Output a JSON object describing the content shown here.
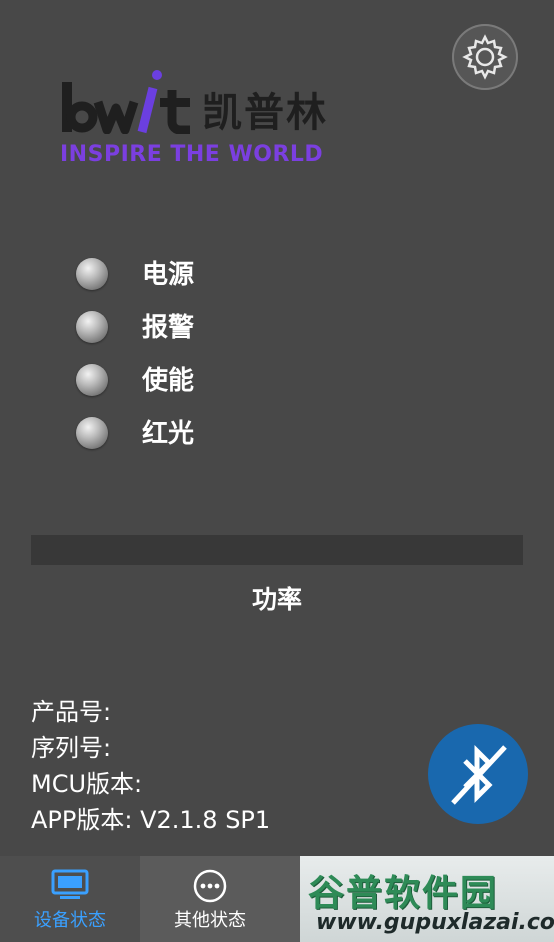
{
  "header": {
    "settings_icon": "gear-icon"
  },
  "logo": {
    "mark": "bwt",
    "brand_cn": "凯普林",
    "slogan": "INSPIRE THE WORLD",
    "colors": {
      "mark": "#1f1f1f",
      "accent": "#7b3fe0"
    }
  },
  "status": {
    "items": [
      {
        "label": "电源",
        "state": "off"
      },
      {
        "label": "报警",
        "state": "off"
      },
      {
        "label": "使能",
        "state": "off"
      },
      {
        "label": "红光",
        "state": "off"
      }
    ]
  },
  "power": {
    "label": "功率",
    "level": 0
  },
  "info": {
    "product_no": "产品号:",
    "serial_no": "序列号:",
    "mcu_version": "MCU版本:",
    "app_version": "APP版本:  V2.1.8 SP1"
  },
  "bluetooth": {
    "icon": "bluetooth-off-icon",
    "color": "#1968ae"
  },
  "nav": {
    "tabs": [
      {
        "label": "设备状态",
        "icon": "monitor-icon",
        "active": true,
        "color": "#3aa0ff"
      },
      {
        "label": "其他状态",
        "icon": "more-dots-icon",
        "active": false,
        "color": "#ffffff"
      }
    ]
  },
  "watermark": {
    "cn": "谷普软件园",
    "url": "www.gupuxlazai.com"
  }
}
